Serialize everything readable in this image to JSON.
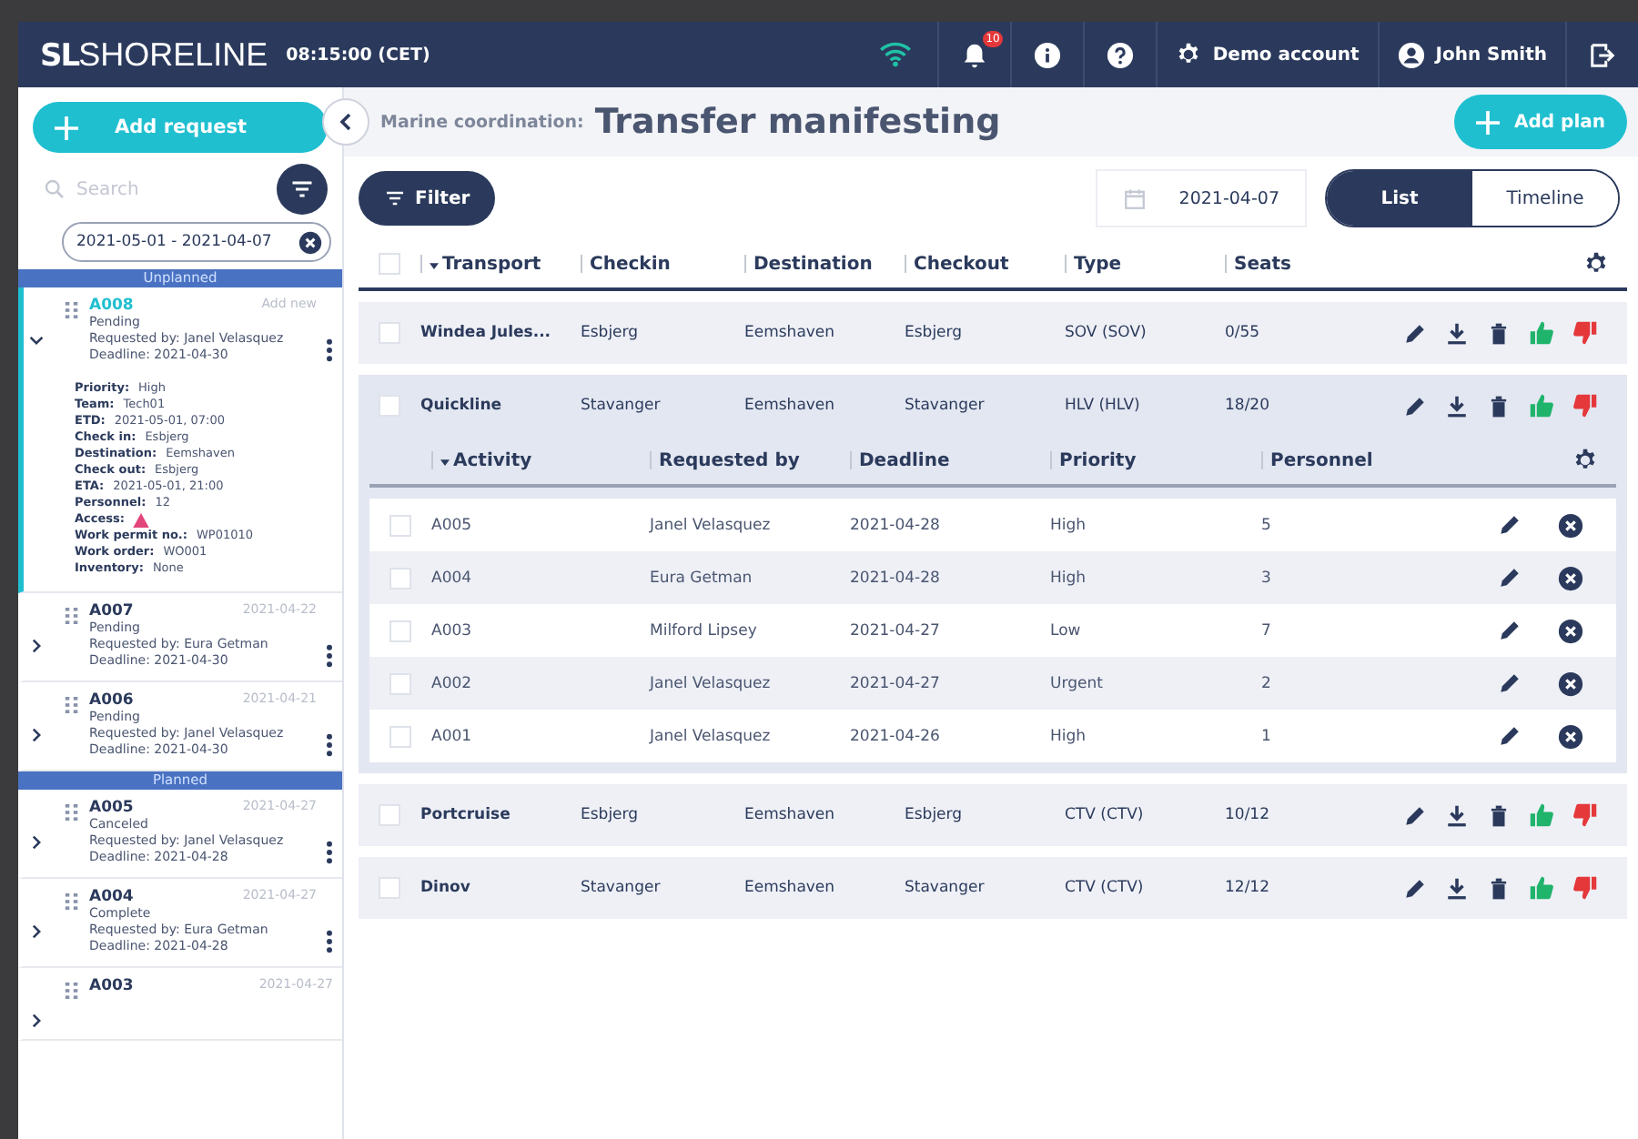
{
  "header": {
    "logo_mark": "SL",
    "logo_text": "SHORELINE",
    "time": "08:15:00 (CET)",
    "notification_badge": "10",
    "account": "Demo account",
    "user": "John Smith"
  },
  "sidebar": {
    "add_button": "Add request",
    "search": {
      "placeholder": "Search"
    },
    "date_range": "2021-05-01 - 2021-04-07",
    "groups": [
      {
        "title": "Unplanned",
        "items": [
          {
            "id": "A008",
            "side": "Add new",
            "status": "Pending",
            "requested_by": "Requested by: Janel Velasquez",
            "deadline": "Deadline: 2021-04-30",
            "expanded": true,
            "selected": true,
            "details": [
              {
                "label": "Priority:",
                "value": "High"
              },
              {
                "label": "Team:",
                "value": "Tech01"
              },
              {
                "label": "ETD:",
                "value": "2021-05-01, 07:00"
              },
              {
                "label": "Check in:",
                "value": "Esbjerg"
              },
              {
                "label": "Destination:",
                "value": "Eemshaven"
              },
              {
                "label": "Check out:",
                "value": "Esbjerg"
              },
              {
                "label": "ETA:",
                "value": "2021-05-01, 21:00"
              },
              {
                "label": "Personnel:",
                "value": "12"
              },
              {
                "label": "Access:",
                "kind": "warning"
              },
              {
                "label": "Work permit no.:",
                "value": "WP01010"
              },
              {
                "label": "Work order:",
                "value": "WO001"
              },
              {
                "label": "Inventory:",
                "value": "None"
              }
            ]
          },
          {
            "id": "A007",
            "side": "2021-04-22",
            "status": "Pending",
            "requested_by": "Requested by: Eura Getman",
            "deadline": "Deadline: 2021-04-30",
            "expanded": false,
            "selected": false
          },
          {
            "id": "A006",
            "side": "2021-04-21",
            "status": "Pending",
            "requested_by": "Requested by: Janel Velasquez",
            "deadline": "Deadline: 2021-04-30",
            "expanded": false,
            "selected": false
          }
        ]
      },
      {
        "title": "Planned",
        "items": [
          {
            "id": "A005",
            "side": "2021-04-27",
            "status": "Canceled",
            "requested_by": "Requested by: Janel Velasquez",
            "deadline": "Deadline: 2021-04-28",
            "expanded": false,
            "selected": false
          },
          {
            "id": "A004",
            "side": "2021-04-27",
            "status": "Complete",
            "requested_by": "Requested by: Eura Getman",
            "deadline": "Deadline: 2021-04-28",
            "expanded": false,
            "selected": false
          },
          {
            "id": "A003",
            "side": "2021-04-27",
            "expanded": false,
            "selected": false
          }
        ]
      }
    ]
  },
  "page": {
    "breadcrumb": "Marine coordination:",
    "title": "Transfer manifesting",
    "add_button": "Add plan"
  },
  "toolbar": {
    "filter": "Filter",
    "date": "2021-04-07",
    "views": [
      {
        "label": "List",
        "selected": true
      },
      {
        "label": "Timeline",
        "selected": false
      }
    ]
  },
  "table": {
    "select_all_checked": false,
    "columns": [
      {
        "label": "Transport",
        "sorted": true
      },
      {
        "label": "Checkin",
        "sorted": false
      },
      {
        "label": "Destination",
        "sorted": false
      },
      {
        "label": "Checkout",
        "sorted": false
      },
      {
        "label": "Type",
        "sorted": false
      },
      {
        "label": "Seats",
        "sorted": false
      }
    ],
    "rows": [
      {
        "cells": [
          "Windea Jules...",
          "Esbjerg",
          "Eemshaven",
          "Esbjerg",
          "SOV (SOV)",
          "0/55"
        ],
        "checked": false,
        "expanded": false
      },
      {
        "cells": [
          "Quickline",
          "Stavanger",
          "Eemshaven",
          "Stavanger",
          "HLV (HLV)",
          "18/20"
        ],
        "checked": false,
        "expanded": true,
        "sub_table": {
          "columns": [
            {
              "label": "Activity",
              "sorted": true
            },
            {
              "label": "Requested by",
              "sorted": false
            },
            {
              "label": "Deadline",
              "sorted": false
            },
            {
              "label": "Priority",
              "sorted": false
            },
            {
              "label": "Personnel",
              "sorted": false
            }
          ],
          "rows": [
            {
              "cells": [
                "A005",
                "Janel Velasquez",
                "2021-04-28",
                "High",
                "5"
              ],
              "checked": false
            },
            {
              "cells": [
                "A004",
                "Eura Getman",
                "2021-04-28",
                "High",
                "3"
              ],
              "checked": false
            },
            {
              "cells": [
                "A003",
                "Milford Lipsey",
                "2021-04-27",
                "Low",
                "7"
              ],
              "checked": false
            },
            {
              "cells": [
                "A002",
                "Janel Velasquez",
                "2021-04-27",
                "Urgent",
                "2"
              ],
              "checked": false
            },
            {
              "cells": [
                "A001",
                "Janel Velasquez",
                "2021-04-26",
                "High",
                "1"
              ],
              "checked": false
            }
          ]
        }
      },
      {
        "cells": [
          "Portcruise",
          "Esbjerg",
          "Eemshaven",
          "Esbjerg",
          "CTV (CTV)",
          "10/12"
        ],
        "checked": false,
        "expanded": false
      },
      {
        "cells": [
          "Dinov",
          "Stavanger",
          "Eemshaven",
          "Stavanger",
          "CTV (CTV)",
          "12/12"
        ],
        "checked": false,
        "expanded": false
      }
    ]
  }
}
